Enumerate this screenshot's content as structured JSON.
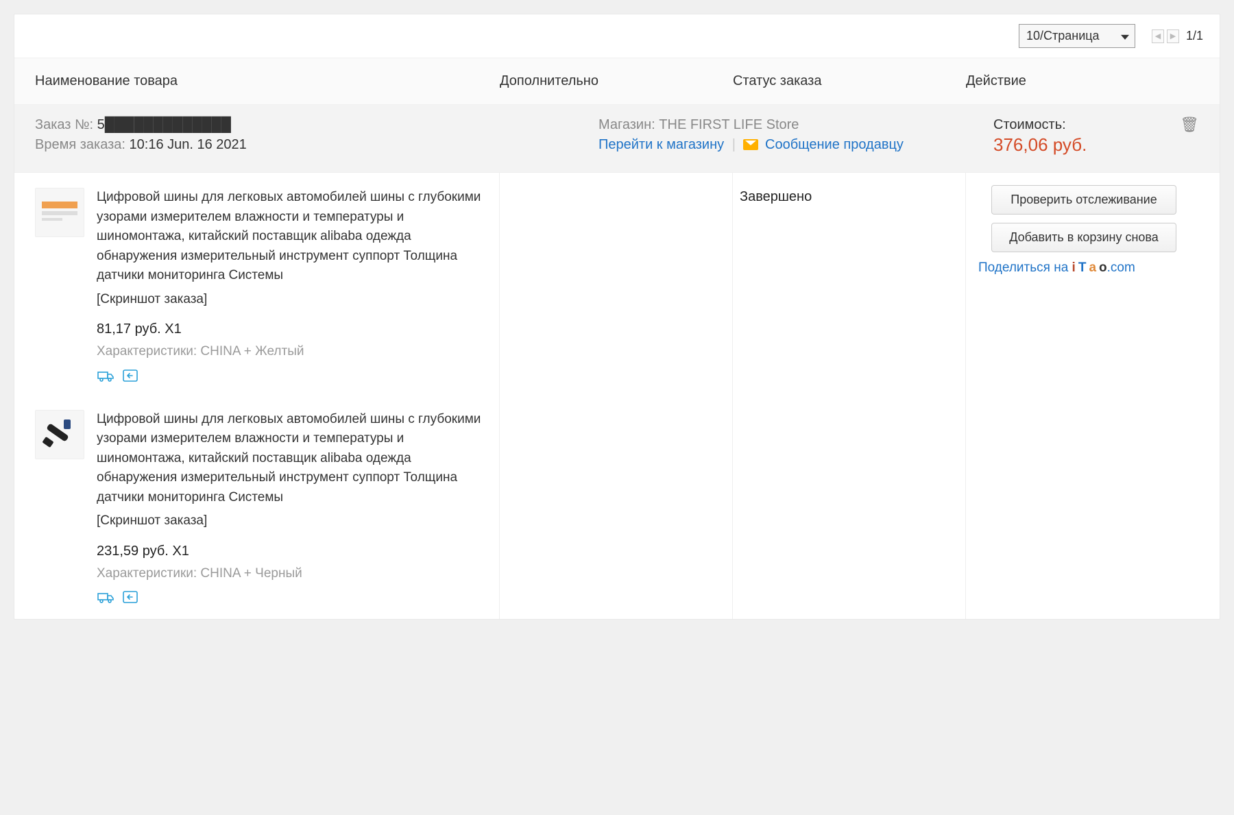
{
  "topbar": {
    "per_page": "10/Страница",
    "page_text": "1/1"
  },
  "headers": {
    "name": "Наименование товара",
    "extra": "Дополнительно",
    "status": "Статус заказа",
    "action": "Действие"
  },
  "order": {
    "num_label": "Заказ №:",
    "num_value": "5█████████████",
    "time_label": "Время заказа:",
    "time_value": "10:16 Jun. 16 2021",
    "store_label": "Магазин:",
    "store_name": "THE FIRST LIFE Store",
    "goto_store": "Перейти к магазину",
    "contact_seller": "Сообщение продавцу",
    "cost_label": "Стоимость:",
    "cost_value": "376,06 руб."
  },
  "status": "Завершено",
  "actions": {
    "track": "Проверить отслеживание",
    "reorder": "Добавить в корзину снова",
    "share_prefix": "Поделиться на "
  },
  "items": [
    {
      "title": "Цифровой шины для легковых автомобилей шины с глубокими узорами измерителем влажности и температуры и шиномонтажа, китайский поставщик alibaba одежда обнаружения измерительный инструмент суппорт Толщина датчики мониторинга Системы",
      "note": "[Скриншот заказа]",
      "price": "81,17 руб. X1",
      "spec": "Характеристики: CHINA + Желтый"
    },
    {
      "title": "Цифровой шины для легковых автомобилей шины с глубокими узорами измерителем влажности и температуры и шиномонтажа, китайский поставщик alibaba одежда обнаружения измерительный инструмент суппорт Толщина датчики мониторинга Системы",
      "note": "[Скриншот заказа]",
      "price": "231,59 руб. X1",
      "spec": "Характеристики: CHINA + Черный"
    }
  ]
}
